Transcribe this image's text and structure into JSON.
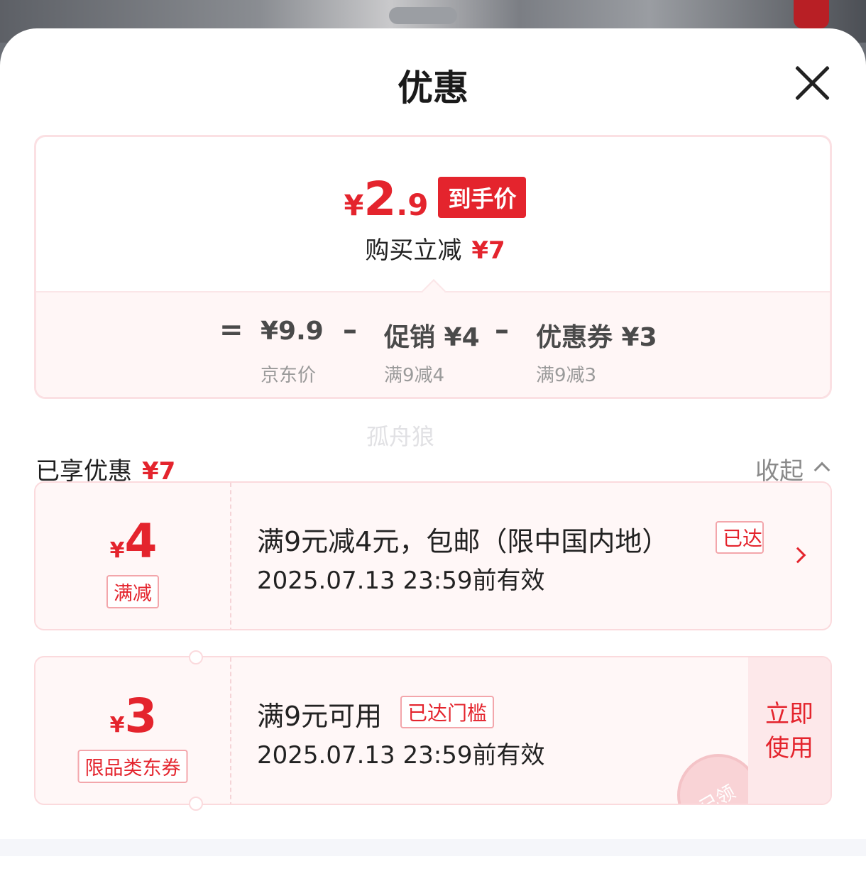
{
  "sheet": {
    "title": "优惠"
  },
  "summary": {
    "final_price_symbol": "¥",
    "final_price_int": "2",
    "final_price_dec": ".9",
    "final_badge": "到手价",
    "reduce_label": "购买立减",
    "reduce_amount": "¥7",
    "equals": "=",
    "minus": "–",
    "base_price": "¥9.9",
    "base_label": "京东价",
    "promo_value": "促销 ¥4",
    "promo_label": "满9减4",
    "coupon_value": "优惠券 ¥3",
    "coupon_label": "满9减3"
  },
  "watermark": "孤舟狼",
  "enjoyed": {
    "label": "已享优惠",
    "amount": "¥7",
    "collapse": "收起"
  },
  "offers": [
    {
      "yen": "¥",
      "amount": "4",
      "tag": "满减",
      "title": "满9元减4元，包邮（限中国内地）",
      "reached": "已达",
      "expiry": "2025.07.13 23:59前有效"
    },
    {
      "yen": "¥",
      "amount": "3",
      "tag": "限品类东券",
      "title": "满9元可用",
      "reached": "已达门槛",
      "expiry": "2025.07.13 23:59前有效",
      "action": "立即使用",
      "stamp": "已领"
    }
  ],
  "colors": {
    "accent": "#e4242d",
    "card_bg": "#fff7f7",
    "border": "#fbdadd"
  }
}
